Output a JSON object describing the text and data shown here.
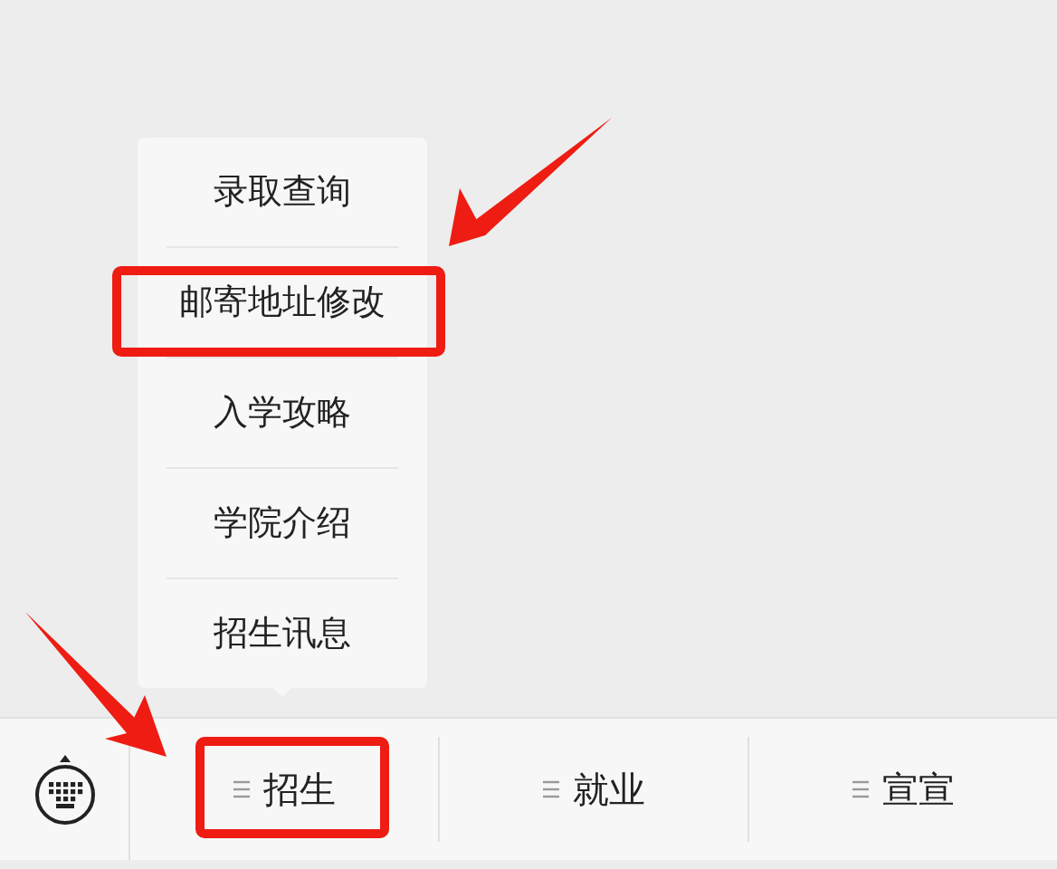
{
  "popup_menu": {
    "items": [
      {
        "label": "录取查询",
        "highlighted": false
      },
      {
        "label": "邮寄地址修改",
        "highlighted": true
      },
      {
        "label": "入学攻略",
        "highlighted": false
      },
      {
        "label": "学院介绍",
        "highlighted": false
      },
      {
        "label": "招生讯息",
        "highlighted": false
      }
    ]
  },
  "bottom_menu": {
    "tabs": [
      {
        "label": "招生",
        "highlighted": true
      },
      {
        "label": "就业",
        "highlighted": false
      },
      {
        "label": "宣宣",
        "highlighted": false
      }
    ]
  }
}
